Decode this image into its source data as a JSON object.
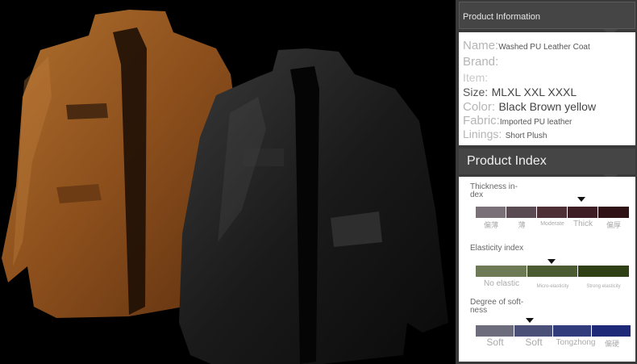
{
  "product_information": {
    "title": "Product Information",
    "rows": [
      {
        "label": "Name:",
        "value": "Washed PU Leather Coat"
      },
      {
        "label": "Brand:",
        "value": ""
      },
      {
        "label": "Item:",
        "value": ""
      },
      {
        "label": "Size:",
        "value": "MLXL XXL XXXL"
      },
      {
        "label": "Color:",
        "value": "Black Brown yellow"
      },
      {
        "label": "Fabric:",
        "value": "Imported PU leather"
      },
      {
        "label": "Linings:",
        "value": "Short Plush"
      }
    ]
  },
  "product_index": {
    "title": "Product Index",
    "thickness": {
      "title_lines": [
        "Thickness in-",
        "dex"
      ],
      "labels": [
        "偏薄",
        "薄",
        "Moderate",
        "Thick",
        "偏厚"
      ],
      "colors": [
        "#7a7078",
        "#5a4a52",
        "#4e2f36",
        "#3e1e24",
        "#2e1216"
      ],
      "selected": "Thick"
    },
    "elasticity": {
      "title_lines": [
        "Elasticity index"
      ],
      "labels": [
        "No elastic",
        "Micro-elasticity",
        "Strong elasticity"
      ],
      "colors": [
        "#6e7a56",
        "#4c5c32",
        "#2f4114"
      ],
      "selected": "Micro-elasticity"
    },
    "softness": {
      "title_lines": [
        "Degree of soft-",
        "ness"
      ],
      "labels": [
        "Soft",
        "Soft",
        "Tongzhong",
        "偏硬"
      ],
      "colors": [
        "#6c6c7c",
        "#4a5078",
        "#303c7c",
        "#1e2a78"
      ],
      "selected_position": 0.35
    }
  }
}
